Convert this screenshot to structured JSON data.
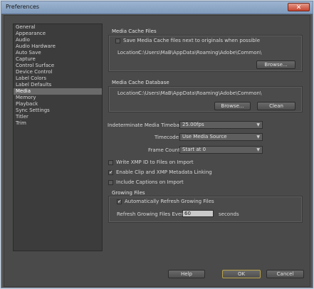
{
  "window": {
    "title": "Preferences",
    "close_glyph": "✕"
  },
  "sidebar": {
    "items": [
      "General",
      "Appearance",
      "Audio",
      "Audio Hardware",
      "Auto Save",
      "Capture",
      "Control Surface",
      "Device Control",
      "Label Colors",
      "Label Defaults",
      "Media",
      "Memory",
      "Playback",
      "Sync Settings",
      "Titler",
      "Trim"
    ],
    "selected": "Media"
  },
  "media_cache_files": {
    "title": "Media Cache Files",
    "save_next_label": "Save Media Cache files next to originals when possible",
    "save_next_checked": false,
    "location_label": "Location:",
    "location_value": "C:\\Users\\MaB\\AppData\\Roaming\\Adobe\\Common\\",
    "browse_label": "Browse..."
  },
  "media_cache_db": {
    "title": "Media Cache Database",
    "location_label": "Location:",
    "location_value": "C:\\Users\\MaB\\AppData\\Roaming\\Adobe\\Common\\",
    "browse_label": "Browse...",
    "clean_label": "Clean"
  },
  "timebase": {
    "label": "Indeterminate Media Timebase:",
    "value": "25.00fps"
  },
  "timecode": {
    "label": "Timecode:",
    "value": "Use Media Source"
  },
  "frame_count": {
    "label": "Frame Count:",
    "value": "Start at 0"
  },
  "checkboxes": {
    "write_xmp": {
      "label": "Write XMP ID to Files on Import",
      "checked": false
    },
    "enable_clip": {
      "label": "Enable Clip and XMP Metadata Linking",
      "checked": true
    },
    "include_captions": {
      "label": "Include Captions on Import",
      "checked": false
    }
  },
  "growing_files": {
    "title": "Growing Files",
    "auto_refresh_label": "Automatically Refresh Growing Files",
    "auto_refresh_checked": true,
    "refresh_every_label": "Refresh Growing Files Every",
    "refresh_value": "60",
    "seconds_label": "seconds"
  },
  "footer": {
    "help_label": "Help",
    "ok_label": "OK",
    "cancel_label": "Cancel"
  },
  "icons": {
    "check": "✓",
    "dropdown": "▼"
  }
}
